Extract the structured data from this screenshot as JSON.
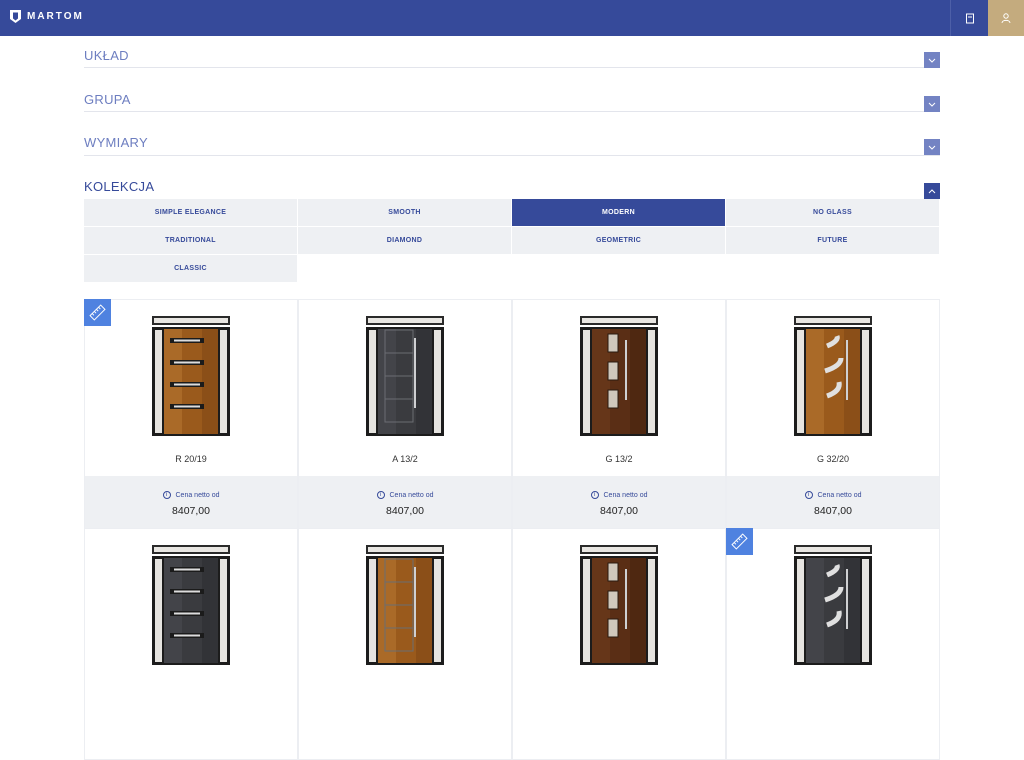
{
  "header": {
    "brand": "MARTOM",
    "cart_icon": "cart-icon",
    "user_icon": "user-icon",
    "colors": {
      "bar": "#364a9a",
      "user_bg": "#c4ab7e"
    }
  },
  "filters": [
    {
      "label": "UKŁAD",
      "expanded": false
    },
    {
      "label": "GRUPA",
      "expanded": false
    },
    {
      "label": "WYMIARY",
      "expanded": false
    },
    {
      "label": "KOLEKCJA",
      "expanded": true
    }
  ],
  "collections": [
    {
      "label": "SIMPLE ELEGANCE",
      "selected": false
    },
    {
      "label": "SMOOTH",
      "selected": false
    },
    {
      "label": "MODERN",
      "selected": true
    },
    {
      "label": "NO GLASS",
      "selected": false
    },
    {
      "label": "TRADITIONAL",
      "selected": false
    },
    {
      "label": "DIAMOND",
      "selected": false
    },
    {
      "label": "GEOMETRIC",
      "selected": false
    },
    {
      "label": "FUTURE",
      "selected": false
    },
    {
      "label": "CLASSIC",
      "selected": false
    }
  ],
  "price_label": "Cena netto od",
  "products": [
    {
      "name": "R 20/19",
      "price": "8407,00",
      "finish": "golden-oak",
      "measure_badge": true
    },
    {
      "name": "A 13/2",
      "price": "8407,00",
      "finish": "anthracite",
      "measure_badge": false
    },
    {
      "name": "G 13/2",
      "price": "8407,00",
      "finish": "walnut",
      "measure_badge": false
    },
    {
      "name": "G 32/20",
      "price": "8407,00",
      "finish": "golden-oak",
      "measure_badge": false
    },
    {
      "name": "",
      "price": "",
      "finish": "anthracite",
      "measure_badge": false
    },
    {
      "name": "",
      "price": "",
      "finish": "golden-oak",
      "measure_badge": false
    },
    {
      "name": "",
      "price": "",
      "finish": "walnut",
      "measure_badge": false
    },
    {
      "name": "",
      "price": "",
      "finish": "anthracite",
      "measure_badge": true
    }
  ]
}
